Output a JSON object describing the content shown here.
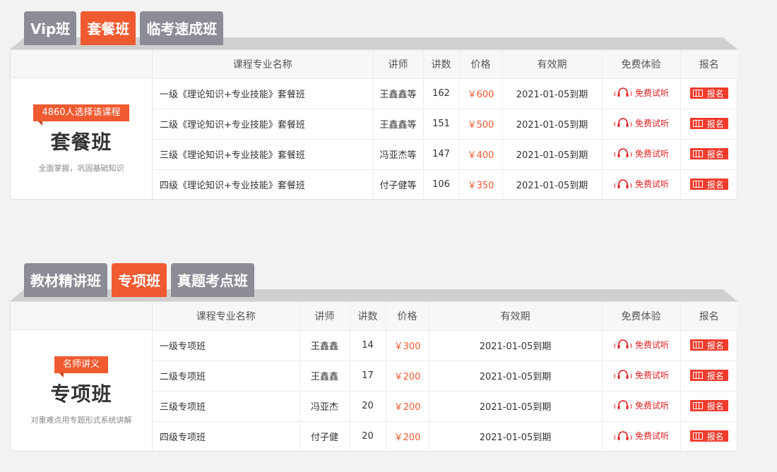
{
  "colors": {
    "accent": "#f05a30",
    "tab_inactive": "#8c8c96",
    "button_red": "#f03c2d"
  },
  "sections": [
    {
      "tabs": [
        "Vip班",
        "套餐班",
        "临考速成班"
      ],
      "active_tab": 1,
      "side": {
        "badge": "4860人选择该课程",
        "title": "套餐班",
        "desc": "全面掌握，巩固基础知识"
      },
      "columns": [
        {
          "key": "name",
          "label": "课程专业名称",
          "width": 312
        },
        {
          "key": "teacher",
          "label": "讲师",
          "width": 71
        },
        {
          "key": "lectures",
          "label": "讲数",
          "width": 51
        },
        {
          "key": "price",
          "label": "价格",
          "width": 61
        },
        {
          "key": "expiry",
          "label": "有效期",
          "width": 141
        },
        {
          "key": "trial",
          "label": "免费体验",
          "width": 111
        },
        {
          "key": "signup",
          "label": "报名",
          "width": 81
        }
      ],
      "rows": [
        {
          "name": "一级《理论知识+专业技能》套餐班",
          "teacher": "王鑫鑫等",
          "lectures": "162",
          "price": "￥600",
          "expiry": "2021-01-05到期",
          "trial": "免费试听",
          "signup": "报名"
        },
        {
          "name": "二级《理论知识+专业技能》套餐班",
          "teacher": "王鑫鑫等",
          "lectures": "151",
          "price": "￥500",
          "expiry": "2021-01-05到期",
          "trial": "免费试听",
          "signup": "报名"
        },
        {
          "name": "三级《理论知识+专业技能》套餐班",
          "teacher": "冯亚杰等",
          "lectures": "147",
          "price": "￥400",
          "expiry": "2021-01-05到期",
          "trial": "免费试听",
          "signup": "报名"
        },
        {
          "name": "四级《理论知识+专业技能》套餐班",
          "teacher": "付子健等",
          "lectures": "106",
          "price": "￥350",
          "expiry": "2021-01-05到期",
          "trial": "免费试听",
          "signup": "报名"
        }
      ]
    },
    {
      "tabs": [
        "教材精讲班",
        "专项班",
        "真题考点班"
      ],
      "active_tab": 1,
      "side": {
        "badge": "名师讲义",
        "title": "专项班",
        "desc": "对重难点用专题形式系统讲解"
      },
      "columns": [
        {
          "key": "name",
          "label": "课程专业名称",
          "width": 208
        },
        {
          "key": "teacher",
          "label": "讲师",
          "width": 71
        },
        {
          "key": "lectures",
          "label": "讲数",
          "width": 51
        },
        {
          "key": "price",
          "label": "价格",
          "width": 61
        },
        {
          "key": "expiry",
          "label": "有效期",
          "width": 245
        },
        {
          "key": "trial",
          "label": "免费体验",
          "width": 111
        },
        {
          "key": "signup",
          "label": "报名",
          "width": 81
        }
      ],
      "rows": [
        {
          "name": "一级专项班",
          "teacher": "王鑫鑫",
          "lectures": "14",
          "price": "￥300",
          "expiry": "2021-01-05到期",
          "trial": "免费试听",
          "signup": "报名"
        },
        {
          "name": "二级专项班",
          "teacher": "王鑫鑫",
          "lectures": "17",
          "price": "￥200",
          "expiry": "2021-01-05到期",
          "trial": "免费试听",
          "signup": "报名"
        },
        {
          "name": "三级专项班",
          "teacher": "冯亚杰",
          "lectures": "20",
          "price": "￥200",
          "expiry": "2021-01-05到期",
          "trial": "免费试听",
          "signup": "报名"
        },
        {
          "name": "四级专项班",
          "teacher": "付子健",
          "lectures": "20",
          "price": "￥200",
          "expiry": "2021-01-05到期",
          "trial": "免费试听",
          "signup": "报名"
        }
      ]
    }
  ]
}
